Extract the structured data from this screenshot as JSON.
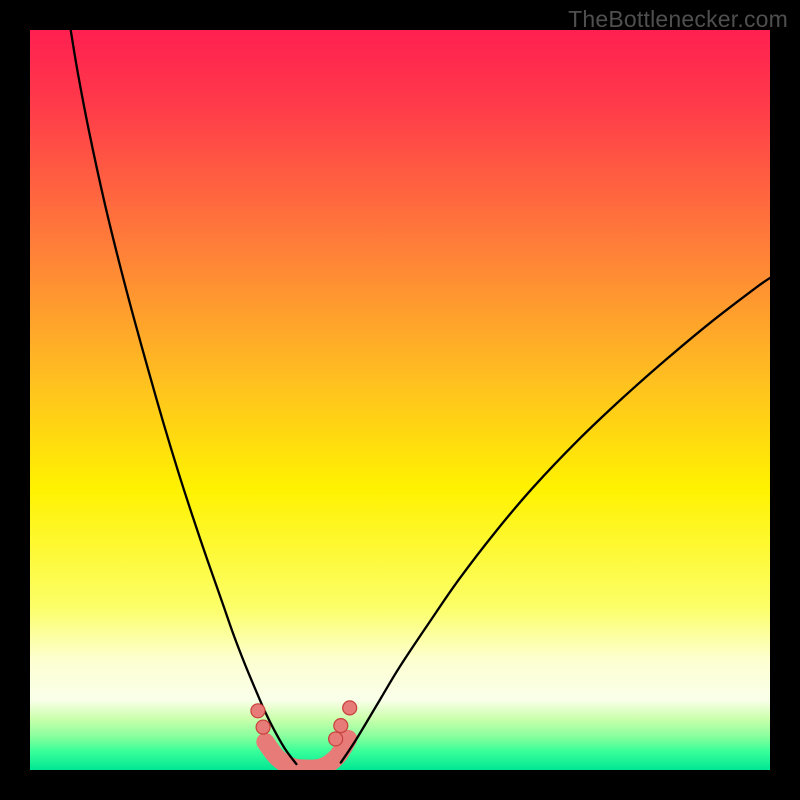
{
  "watermark": "TheBottlenecker.com",
  "chart_data": {
    "type": "line",
    "title": "",
    "xlabel": "",
    "ylabel": "",
    "xlim": [
      0,
      1
    ],
    "ylim": [
      0,
      1
    ],
    "gradient_stops": [
      {
        "offset": 0.0,
        "color": "#ff2050"
      },
      {
        "offset": 0.1,
        "color": "#ff3a4a"
      },
      {
        "offset": 0.3,
        "color": "#ff8138"
      },
      {
        "offset": 0.48,
        "color": "#ffc21f"
      },
      {
        "offset": 0.62,
        "color": "#fff200"
      },
      {
        "offset": 0.78,
        "color": "#fcff68"
      },
      {
        "offset": 0.85,
        "color": "#fdffcf"
      },
      {
        "offset": 0.905,
        "color": "#faffea"
      },
      {
        "offset": 0.93,
        "color": "#cdffad"
      },
      {
        "offset": 0.955,
        "color": "#87ff9d"
      },
      {
        "offset": 0.975,
        "color": "#38ff9a"
      },
      {
        "offset": 1.0,
        "color": "#00e693"
      }
    ],
    "series": [
      {
        "name": "left-curve",
        "x": [
          0.055,
          0.065,
          0.08,
          0.1,
          0.12,
          0.14,
          0.16,
          0.18,
          0.2,
          0.22,
          0.24,
          0.26,
          0.275,
          0.29,
          0.305,
          0.318,
          0.33,
          0.345,
          0.36
        ],
        "y": [
          1.0,
          0.94,
          0.862,
          0.77,
          0.688,
          0.612,
          0.54,
          0.47,
          0.404,
          0.342,
          0.283,
          0.226,
          0.183,
          0.144,
          0.108,
          0.078,
          0.054,
          0.028,
          0.008
        ]
      },
      {
        "name": "right-curve",
        "x": [
          0.42,
          0.44,
          0.47,
          0.5,
          0.54,
          0.58,
          0.63,
          0.68,
          0.74,
          0.8,
          0.86,
          0.92,
          0.98,
          1.0
        ],
        "y": [
          0.01,
          0.04,
          0.09,
          0.14,
          0.2,
          0.258,
          0.323,
          0.382,
          0.445,
          0.502,
          0.555,
          0.605,
          0.651,
          0.665
        ]
      },
      {
        "name": "valley-floor",
        "x": [
          0.318,
          0.335,
          0.355,
          0.375,
          0.395,
          0.415,
          0.43
        ],
        "y": [
          0.038,
          0.016,
          0.004,
          0.002,
          0.004,
          0.018,
          0.042
        ]
      }
    ],
    "markers": [
      {
        "x": 0.308,
        "y": 0.08,
        "r": 7
      },
      {
        "x": 0.315,
        "y": 0.058,
        "r": 7
      },
      {
        "x": 0.413,
        "y": 0.042,
        "r": 7
      },
      {
        "x": 0.42,
        "y": 0.06,
        "r": 7
      },
      {
        "x": 0.432,
        "y": 0.084,
        "r": 7
      }
    ],
    "marker_style": {
      "fill": "#e77b77",
      "stroke": "#c8403c"
    },
    "valley_style": {
      "stroke": "#e77b77",
      "width": 18
    },
    "curve_style": {
      "stroke": "#000000",
      "width": 2.3
    }
  }
}
